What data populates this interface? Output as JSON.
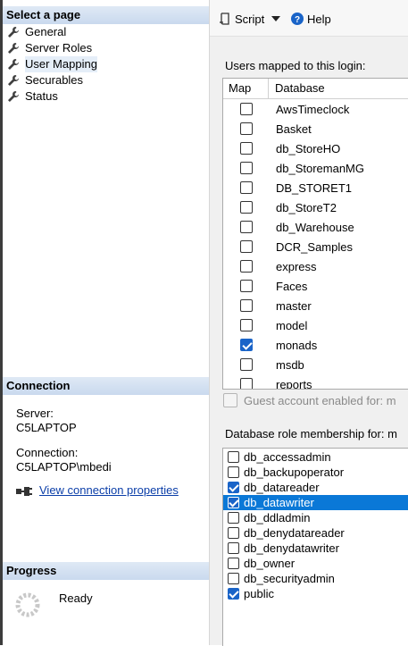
{
  "left_panel": {
    "select_page": {
      "header": "Select a page",
      "items": [
        {
          "label": "General"
        },
        {
          "label": "Server Roles"
        },
        {
          "label": "User Mapping",
          "selected": true
        },
        {
          "label": "Securables"
        },
        {
          "label": "Status"
        }
      ]
    },
    "connection": {
      "header": "Connection",
      "server_label": "Server:",
      "server_value": "C5LAPTOP",
      "connection_label": "Connection:",
      "connection_value": "C5LAPTOP\\mbedi",
      "view_properties_link": "View connection properties"
    },
    "progress": {
      "header": "Progress",
      "status": "Ready"
    }
  },
  "toolbar": {
    "script_label": "Script",
    "help_label": "Help"
  },
  "users_mapped": {
    "caption": "Users mapped to this login:",
    "columns": {
      "map": "Map",
      "database": "Database"
    },
    "rows": [
      {
        "database": "AwsTimeclock",
        "mapped": false
      },
      {
        "database": "Basket",
        "mapped": false
      },
      {
        "database": "db_StoreHO",
        "mapped": false
      },
      {
        "database": "db_StoremanMG",
        "mapped": false
      },
      {
        "database": "DB_STORET1",
        "mapped": false
      },
      {
        "database": "db_StoreT2",
        "mapped": false
      },
      {
        "database": "db_Warehouse",
        "mapped": false
      },
      {
        "database": "DCR_Samples",
        "mapped": false
      },
      {
        "database": "express",
        "mapped": false
      },
      {
        "database": "Faces",
        "mapped": false
      },
      {
        "database": "master",
        "mapped": false
      },
      {
        "database": "model",
        "mapped": false
      },
      {
        "database": "monads",
        "mapped": true
      },
      {
        "database": "msdb",
        "mapped": false
      },
      {
        "database": "reports",
        "mapped": false
      }
    ]
  },
  "guest_account": {
    "label": "Guest account enabled for: m"
  },
  "role_membership": {
    "caption": "Database role membership for: m",
    "roles": [
      {
        "label": "db_accessadmin",
        "checked": false,
        "selected": false
      },
      {
        "label": "db_backupoperator",
        "checked": false,
        "selected": false
      },
      {
        "label": "db_datareader",
        "checked": true,
        "selected": false
      },
      {
        "label": "db_datawriter",
        "checked": true,
        "selected": true
      },
      {
        "label": "db_ddladmin",
        "checked": false,
        "selected": false
      },
      {
        "label": "db_denydatareader",
        "checked": false,
        "selected": false
      },
      {
        "label": "db_denydatawriter",
        "checked": false,
        "selected": false
      },
      {
        "label": "db_owner",
        "checked": false,
        "selected": false
      },
      {
        "label": "db_securityadmin",
        "checked": false,
        "selected": false
      },
      {
        "label": "public",
        "checked": true,
        "selected": false
      }
    ]
  },
  "colors": {
    "accent": "#1a64c8",
    "selection": "#0a78d7",
    "link": "#0b3ea8"
  }
}
